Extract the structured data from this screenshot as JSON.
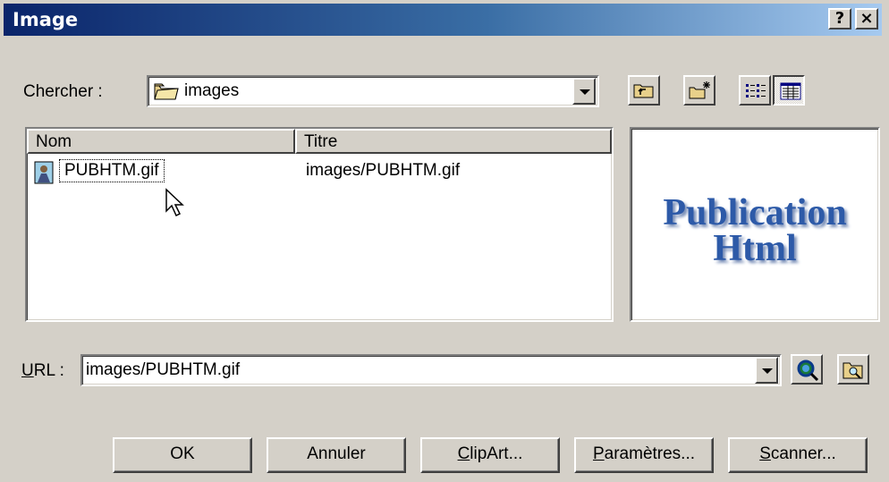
{
  "window": {
    "title": "Image",
    "help_label": "?",
    "close_label": "×"
  },
  "lookin": {
    "label": "Chercher :",
    "value": "images"
  },
  "file_list": {
    "columns": [
      "Nom",
      "Titre"
    ],
    "rows": [
      {
        "name": "PUBHTM.gif",
        "title": "images/PUBHTM.gif"
      }
    ]
  },
  "preview": {
    "line1": "Publication",
    "line2": "Html"
  },
  "url": {
    "label_prefix": "U",
    "label_rest": "RL :",
    "value": "images/PUBHTM.gif"
  },
  "buttons": {
    "ok": "OK",
    "cancel": "Annuler",
    "clipart_u": "C",
    "clipart_rest": "lipArt...",
    "params_u": "P",
    "params_rest": "aramètres...",
    "scanner_u": "S",
    "scanner_rest": "canner..."
  },
  "colors": {
    "title_start": "#0a246a",
    "title_end": "#a6caf0",
    "face": "#d4d0c8",
    "preview_text": "#2d5aa8"
  },
  "icons": [
    "folder-icon",
    "up-folder-icon",
    "new-folder-icon",
    "list-view-icon",
    "details-view-icon",
    "gif-file-icon",
    "browse-web-icon",
    "browse-folder-icon",
    "mouse-cursor-icon"
  ]
}
